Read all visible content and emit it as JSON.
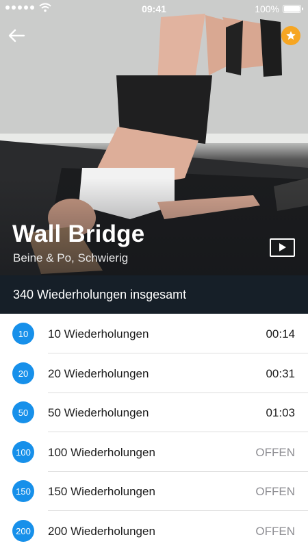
{
  "status_bar": {
    "time": "09:41",
    "battery": "100%"
  },
  "exercise": {
    "title": "Wall Bridge",
    "subtitle": "Beine & Po, Schwierig",
    "total": "340 Wiederholungen insgesamt"
  },
  "icons": {
    "back": "arrow-left-icon",
    "favorite": "star-icon",
    "video": "play-icon"
  },
  "colors": {
    "accent": "#1790ea",
    "favorite": "#f6a623",
    "total_bar": "#161f28",
    "open_text": "#8e8e93"
  },
  "levels": [
    {
      "badge": "10",
      "label": "10 Wiederholungen",
      "value": "00:14"
    },
    {
      "badge": "20",
      "label": "20 Wiederholungen",
      "value": "00:31"
    },
    {
      "badge": "50",
      "label": "50 Wiederholungen",
      "value": "01:03"
    },
    {
      "badge": "100",
      "label": "100 Wiederholungen",
      "value": "OFFEN"
    },
    {
      "badge": "150",
      "label": "150 Wiederholungen",
      "value": "OFFEN"
    },
    {
      "badge": "200",
      "label": "200 Wiederholungen",
      "value": "OFFEN"
    }
  ]
}
